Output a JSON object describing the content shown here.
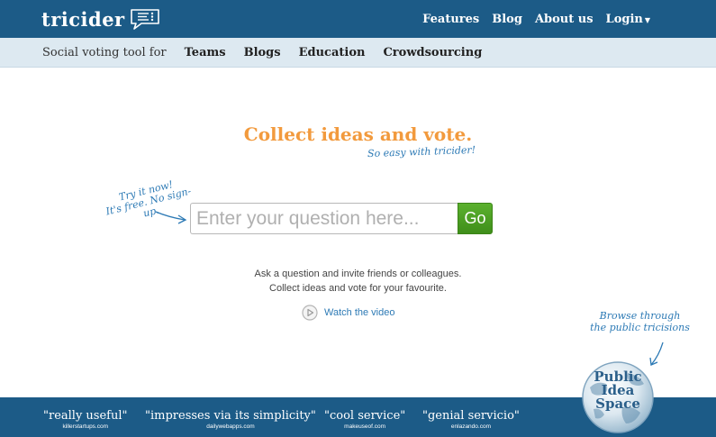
{
  "header": {
    "logo_text": "tricider",
    "nav": [
      {
        "label": "Features"
      },
      {
        "label": "Blog"
      },
      {
        "label": "About us"
      },
      {
        "label": "Login"
      }
    ]
  },
  "subnav": {
    "tagline": "Social voting tool for",
    "links": [
      {
        "label": "Teams"
      },
      {
        "label": "Blogs"
      },
      {
        "label": "Education"
      },
      {
        "label": "Crowdsourcing"
      }
    ]
  },
  "hero": {
    "headline": "Collect ideas and vote.",
    "subheadline": "So easy with tricider!",
    "tryit_line1": "Try it now!",
    "tryit_line2": "It's free. No sign-up.",
    "search_placeholder": "Enter your question here...",
    "go_label": "Go",
    "desc_line1": "Ask a question and invite friends or colleagues.",
    "desc_line2": "Collect ideas and vote for your favourite.",
    "video_label": "Watch the video"
  },
  "public_space": {
    "browse_line1": "Browse through",
    "browse_line2": "the public tricisions",
    "label_line1": "Public",
    "label_line2": "Idea",
    "label_line3": "Space"
  },
  "footer": {
    "quotes": [
      {
        "text": "\"really useful\"",
        "source": "killerstartups.com"
      },
      {
        "text": "\"impresses via its simplicity\"",
        "source": "dailywebapps.com"
      },
      {
        "text": "\"cool service\"",
        "source": "makeuseof.com"
      },
      {
        "text": "\"genial servicio\"",
        "source": "enlazando.com"
      }
    ]
  },
  "colors": {
    "brand_blue": "#1c5b87",
    "subnav_bg": "#dde9f1",
    "headline_orange": "#f29a3d",
    "accent_blue": "#2d7ab5",
    "go_green": "#4aa022"
  },
  "icons": [
    "speech-bubble-logo-icon",
    "caret-down-icon",
    "play-circle-icon",
    "globe-icon",
    "arrow-icon"
  ]
}
